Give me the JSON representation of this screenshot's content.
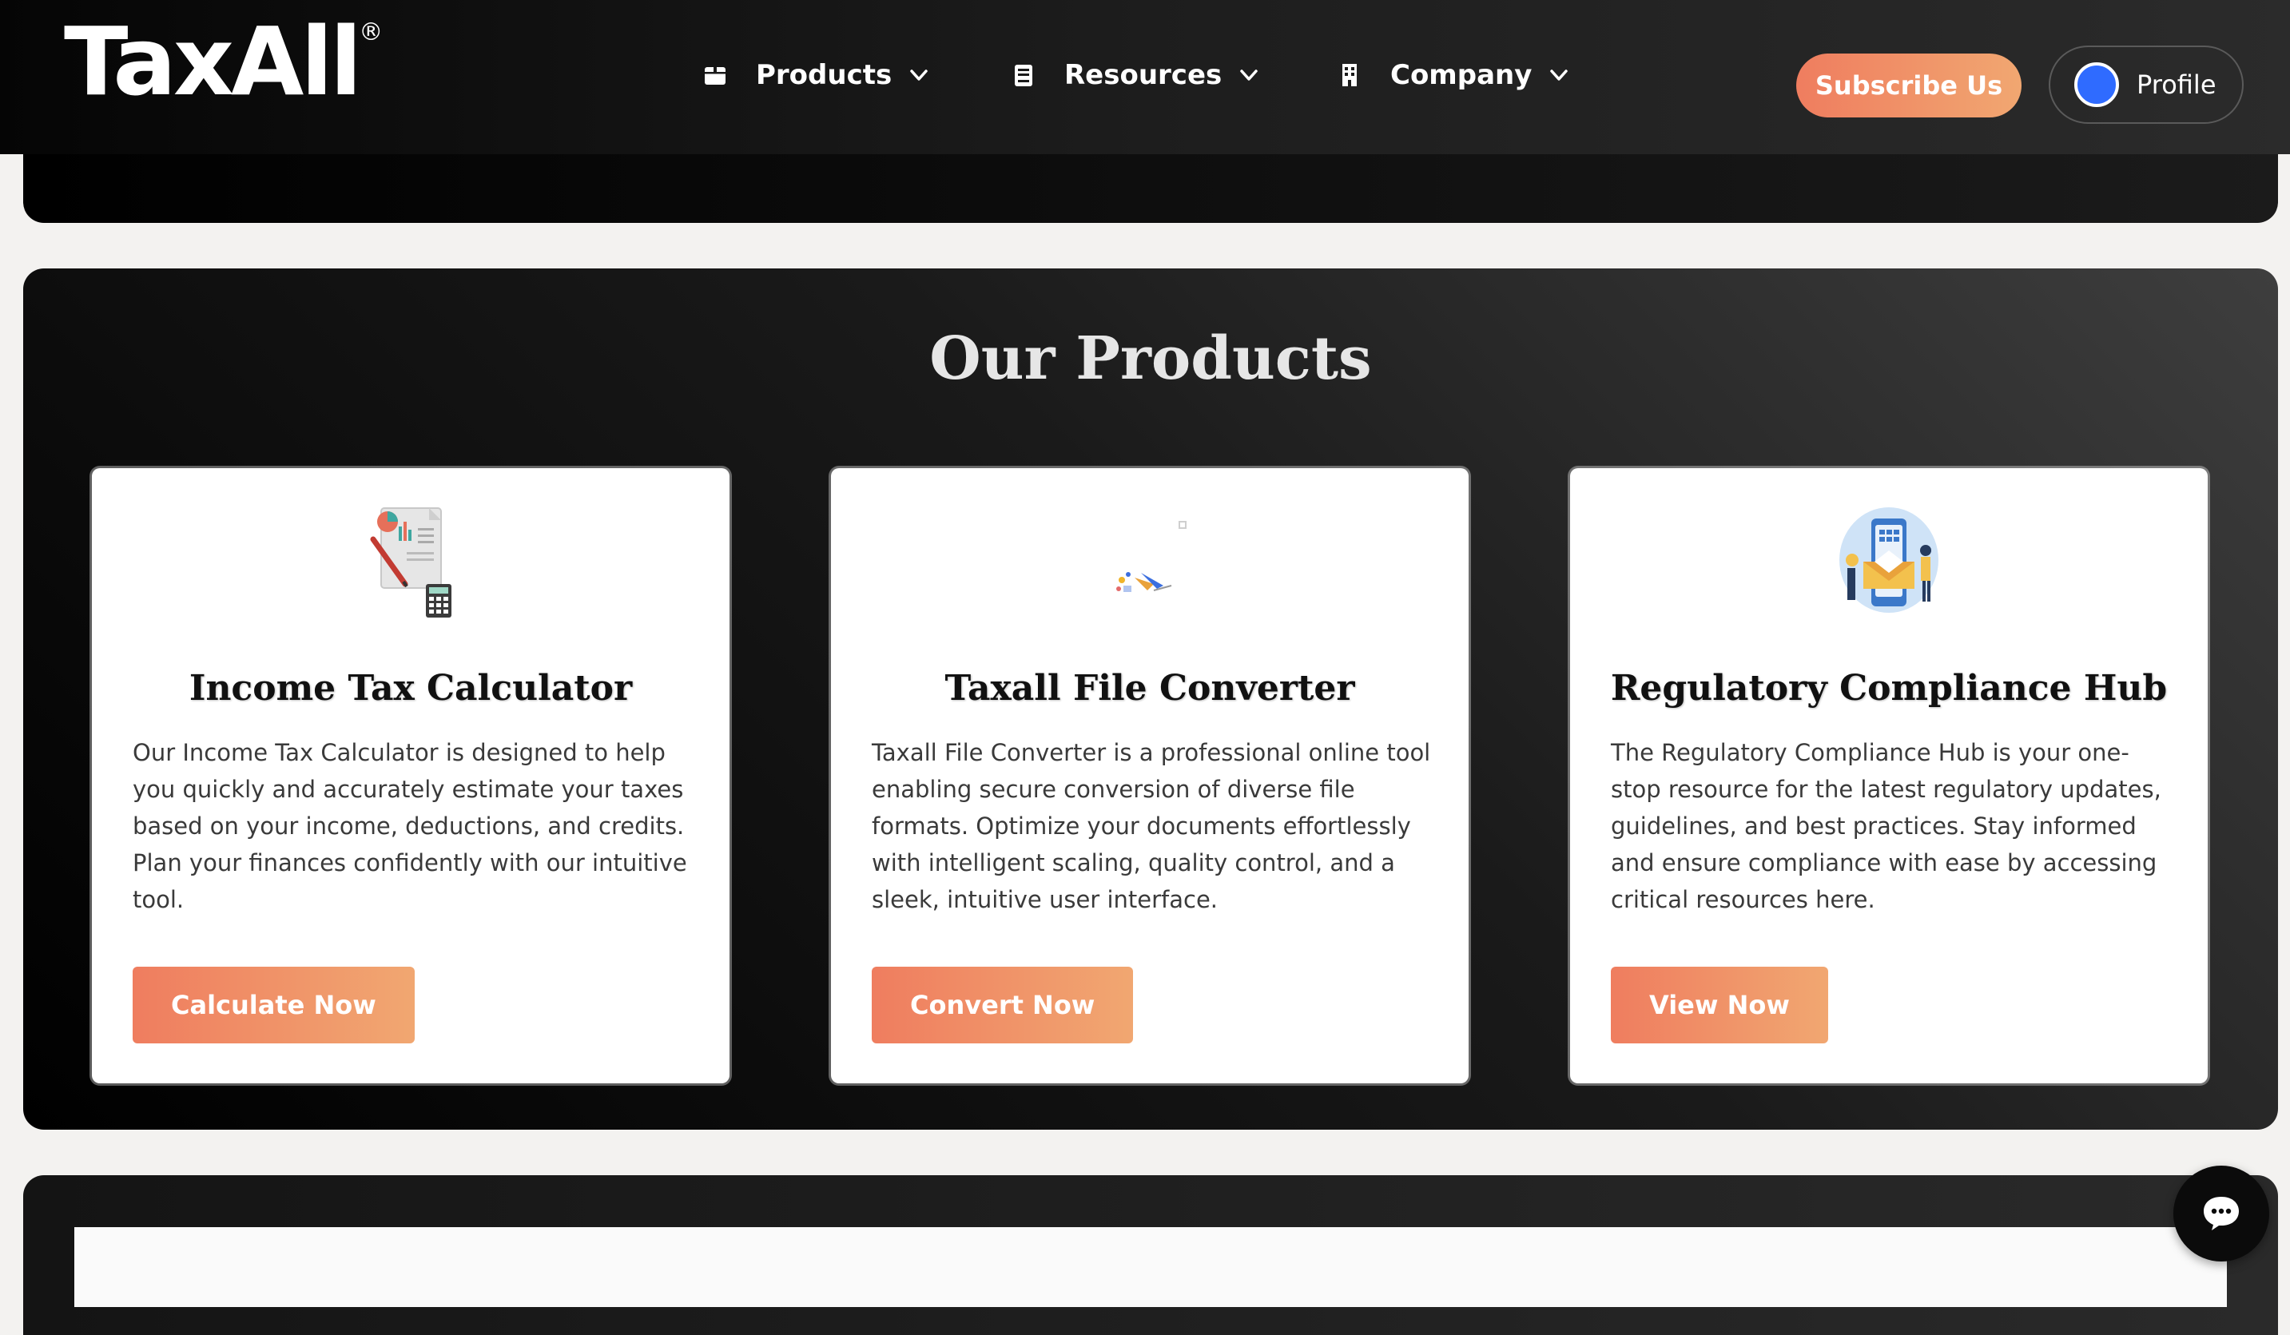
{
  "header": {
    "logo_text": "TaxAll",
    "logo_mark": "®",
    "nav": [
      {
        "label": "Products",
        "icon": "box-icon"
      },
      {
        "label": "Resources",
        "icon": "book-icon"
      },
      {
        "label": "Company",
        "icon": "building-icon"
      }
    ],
    "subscribe_label": "Subscribe Us",
    "profile_label": "Profile"
  },
  "products": {
    "title": "Our Products",
    "cards": [
      {
        "title": "Income Tax Calculator",
        "description": "Our Income Tax Calculator is designed to help you quickly and accurately estimate your taxes based on your income, deductions, and credits. Plan your finances confidently with our intuitive tool.",
        "button": "Calculate Now",
        "illustration": "tax-document-calculator-illustration"
      },
      {
        "title": "Taxall File Converter",
        "description": "Taxall File Converter is a professional online tool enabling secure conversion of diverse file formats. Optimize your documents effortlessly with intelligent scaling, quality control, and a sleek, intuitive user interface.",
        "button": "Convert Now",
        "illustration": "file-conversion-illustration"
      },
      {
        "title": "Regulatory Compliance Hub",
        "description": "The Regulatory Compliance Hub is your one-stop resource for the latest regulatory updates, guidelines, and best practices. Stay informed and ensure compliance with ease by accessing critical resources here.",
        "button": "View Now",
        "illustration": "compliance-hub-illustration"
      }
    ]
  },
  "colors": {
    "accent_start": "#ef7d5f",
    "accent_end": "#f1a771",
    "avatar": "#2f6bff",
    "page_bg": "#f3f2f0"
  },
  "chat_icon": "chat-bubble-icon"
}
